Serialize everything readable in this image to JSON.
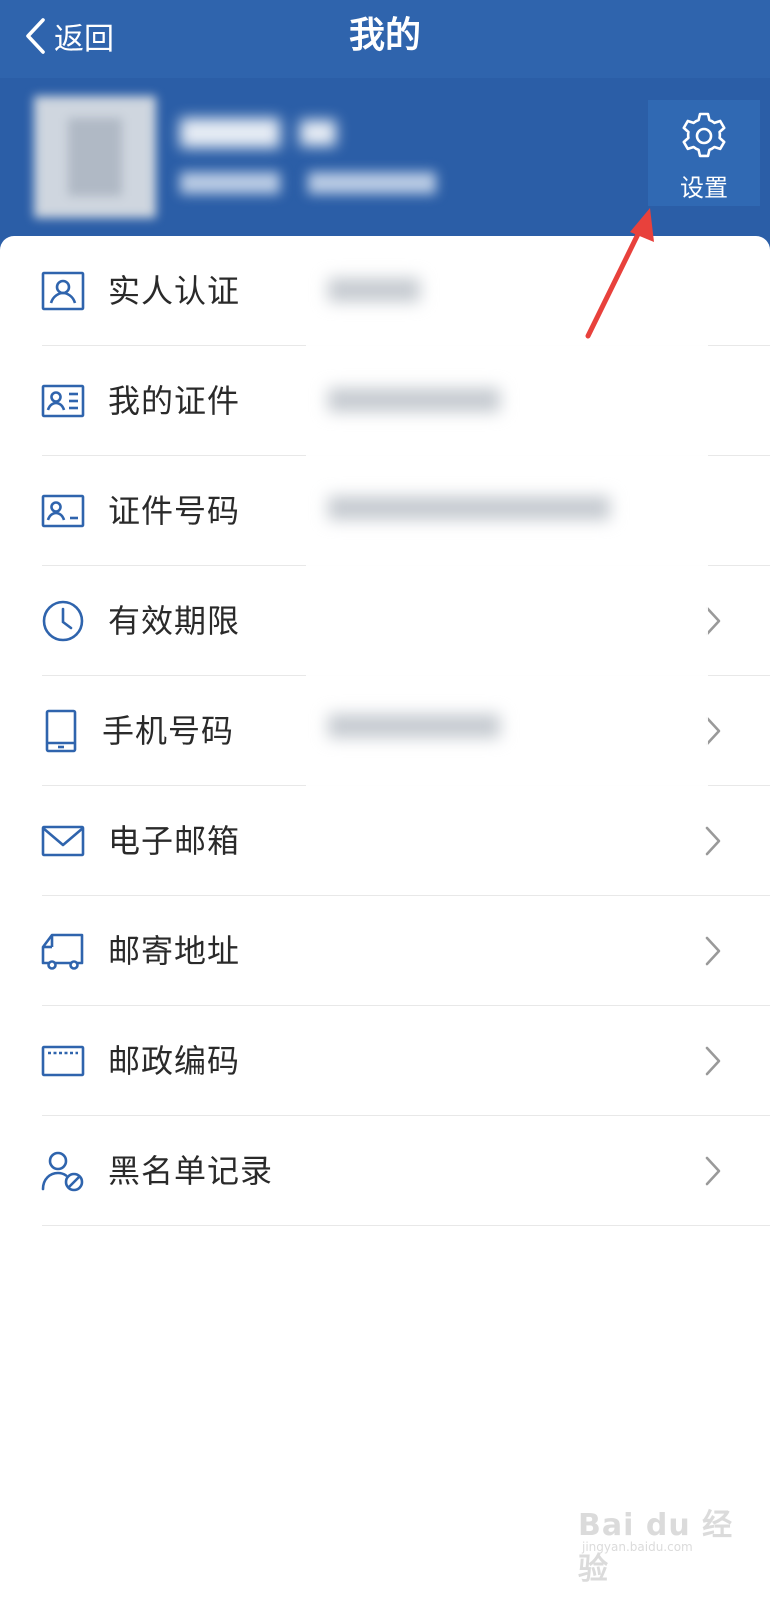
{
  "header": {
    "back_label": "返回",
    "title": "我的",
    "settings_label": "设置",
    "background_color": "#2b5ea7",
    "back_icon": "chevron-left-icon",
    "settings_icon": "gear-icon"
  },
  "menu": {
    "items": [
      {
        "label": "实人认证",
        "icon": "person-id-icon",
        "has_chevron": false
      },
      {
        "label": "我的证件",
        "icon": "id-card-icon",
        "has_chevron": false
      },
      {
        "label": "证件号码",
        "icon": "id-number-icon",
        "has_chevron": false
      },
      {
        "label": "有效期限",
        "icon": "clock-icon",
        "has_chevron": true
      },
      {
        "label": "手机号码",
        "icon": "phone-icon",
        "has_chevron": true
      },
      {
        "label": "电子邮箱",
        "icon": "envelope-icon",
        "has_chevron": true
      },
      {
        "label": "邮寄地址",
        "icon": "delivery-truck-icon",
        "has_chevron": true
      },
      {
        "label": "邮政编码",
        "icon": "postcode-icon",
        "has_chevron": true
      },
      {
        "label": "黑名单记录",
        "icon": "blocked-user-icon",
        "has_chevron": true
      }
    ]
  },
  "watermark": {
    "text": "Bai du 经验",
    "url_text": "jingyan.baidu.com"
  },
  "colors": {
    "accent": "#2b5ea7",
    "icon": "#2f64ad",
    "annotation": "#e8413c"
  }
}
